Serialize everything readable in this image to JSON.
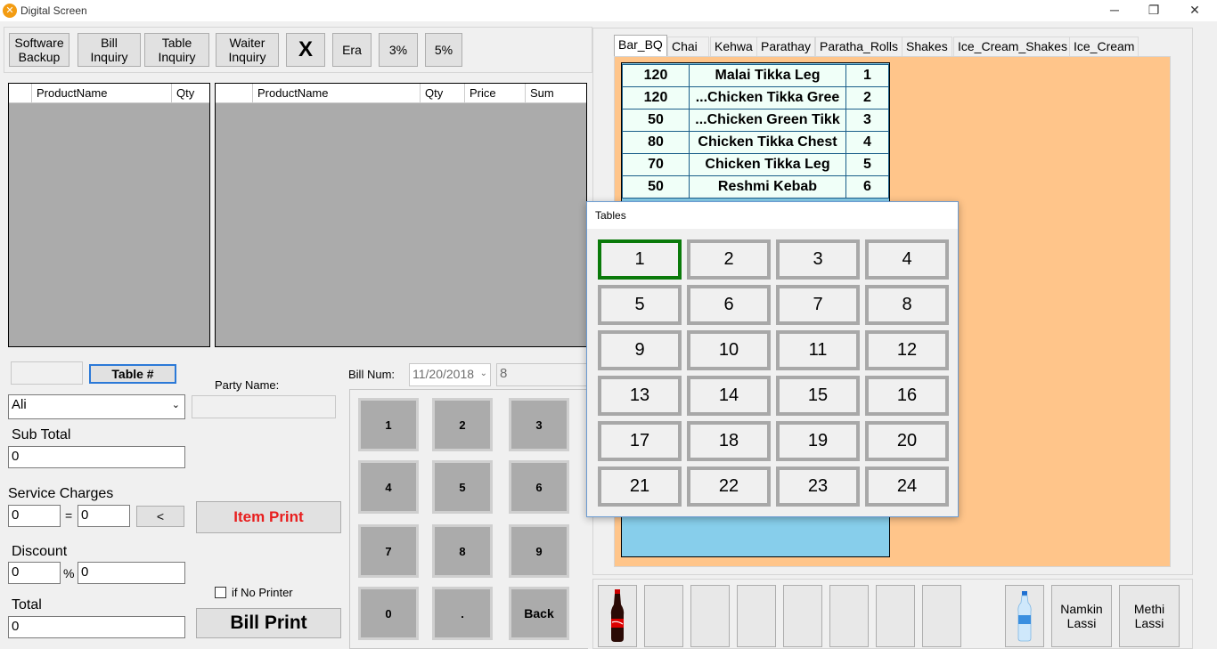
{
  "window": {
    "title": "Digital Screen",
    "minimize": "─",
    "restore": "❐",
    "close": "✕"
  },
  "toolbar": {
    "software_backup": "Software\nBackup",
    "bill_inquiry": "Bill\nInquiry",
    "table_inquiry": "Table\nInquiry",
    "waiter_inquiry": "Waiter\nInquiry",
    "x": "X",
    "era": "Era",
    "pct3": "3%",
    "pct5": "5%"
  },
  "grid_left": {
    "columns": [
      "ProductName",
      "Qty"
    ]
  },
  "grid_right": {
    "columns": [
      "ProductName",
      "Qty",
      "Price",
      "Sum"
    ]
  },
  "order": {
    "table_button": "Table #",
    "party_name_label": "Party Name:",
    "waiter_value": "Ali",
    "bill_num_label": "Bill Num:",
    "date_value": "11/20/2018",
    "bill_num_value": "8",
    "sub_total_label": "Sub Total",
    "sub_total_value": "0",
    "service_label": "Service Charges",
    "service_pct": "0",
    "equals": "=",
    "service_value": "0",
    "lt_button": "<",
    "item_print": "Item Print",
    "discount_label": "Discount",
    "discount_pct": "0",
    "pct_sign": "%",
    "discount_value": "0",
    "no_printer_label": "if No Printer",
    "total_label": "Total",
    "total_value": "0",
    "bill_print": "Bill Print"
  },
  "keypad": [
    "1",
    "2",
    "3",
    "4",
    "5",
    "6",
    "7",
    "8",
    "9",
    "0",
    ".",
    "Back"
  ],
  "tabs": [
    "Bar_BQ",
    "Chai",
    "Kehwa",
    "Parathay",
    "Paratha_Rolls",
    "Shakes",
    "Ice_Cream_Shakes",
    "Ice_Cream"
  ],
  "products": [
    {
      "price": "120",
      "name": "Malai Tikka Leg",
      "no": "1"
    },
    {
      "price": "120",
      "name": "...Chicken Tikka Gree",
      "no": "2"
    },
    {
      "price": "50",
      "name": "...Chicken Green Tikk",
      "no": "3"
    },
    {
      "price": "80",
      "name": "Chicken Tikka Chest",
      "no": "4"
    },
    {
      "price": "70",
      "name": "Chicken Tikka Leg",
      "no": "5"
    },
    {
      "price": "50",
      "name": "Reshmi Kebab",
      "no": "6"
    }
  ],
  "tables_dialog": {
    "title": "Tables",
    "tables": [
      "1",
      "2",
      "3",
      "4",
      "5",
      "6",
      "7",
      "8",
      "9",
      "10",
      "11",
      "12",
      "13",
      "14",
      "15",
      "16",
      "17",
      "18",
      "19",
      "20",
      "21",
      "22",
      "23",
      "24"
    ],
    "selected": "1"
  },
  "quick_items": {
    "namkin_lassi": "Namkin\nLassi",
    "methi_lassi": "Methi\nLassi"
  },
  "colors": {
    "accent_red": "#e81e1e",
    "selected_table": "#0a7a0a",
    "product_panel": "#ffc58a",
    "product_list_bg": "#87ceeb"
  }
}
